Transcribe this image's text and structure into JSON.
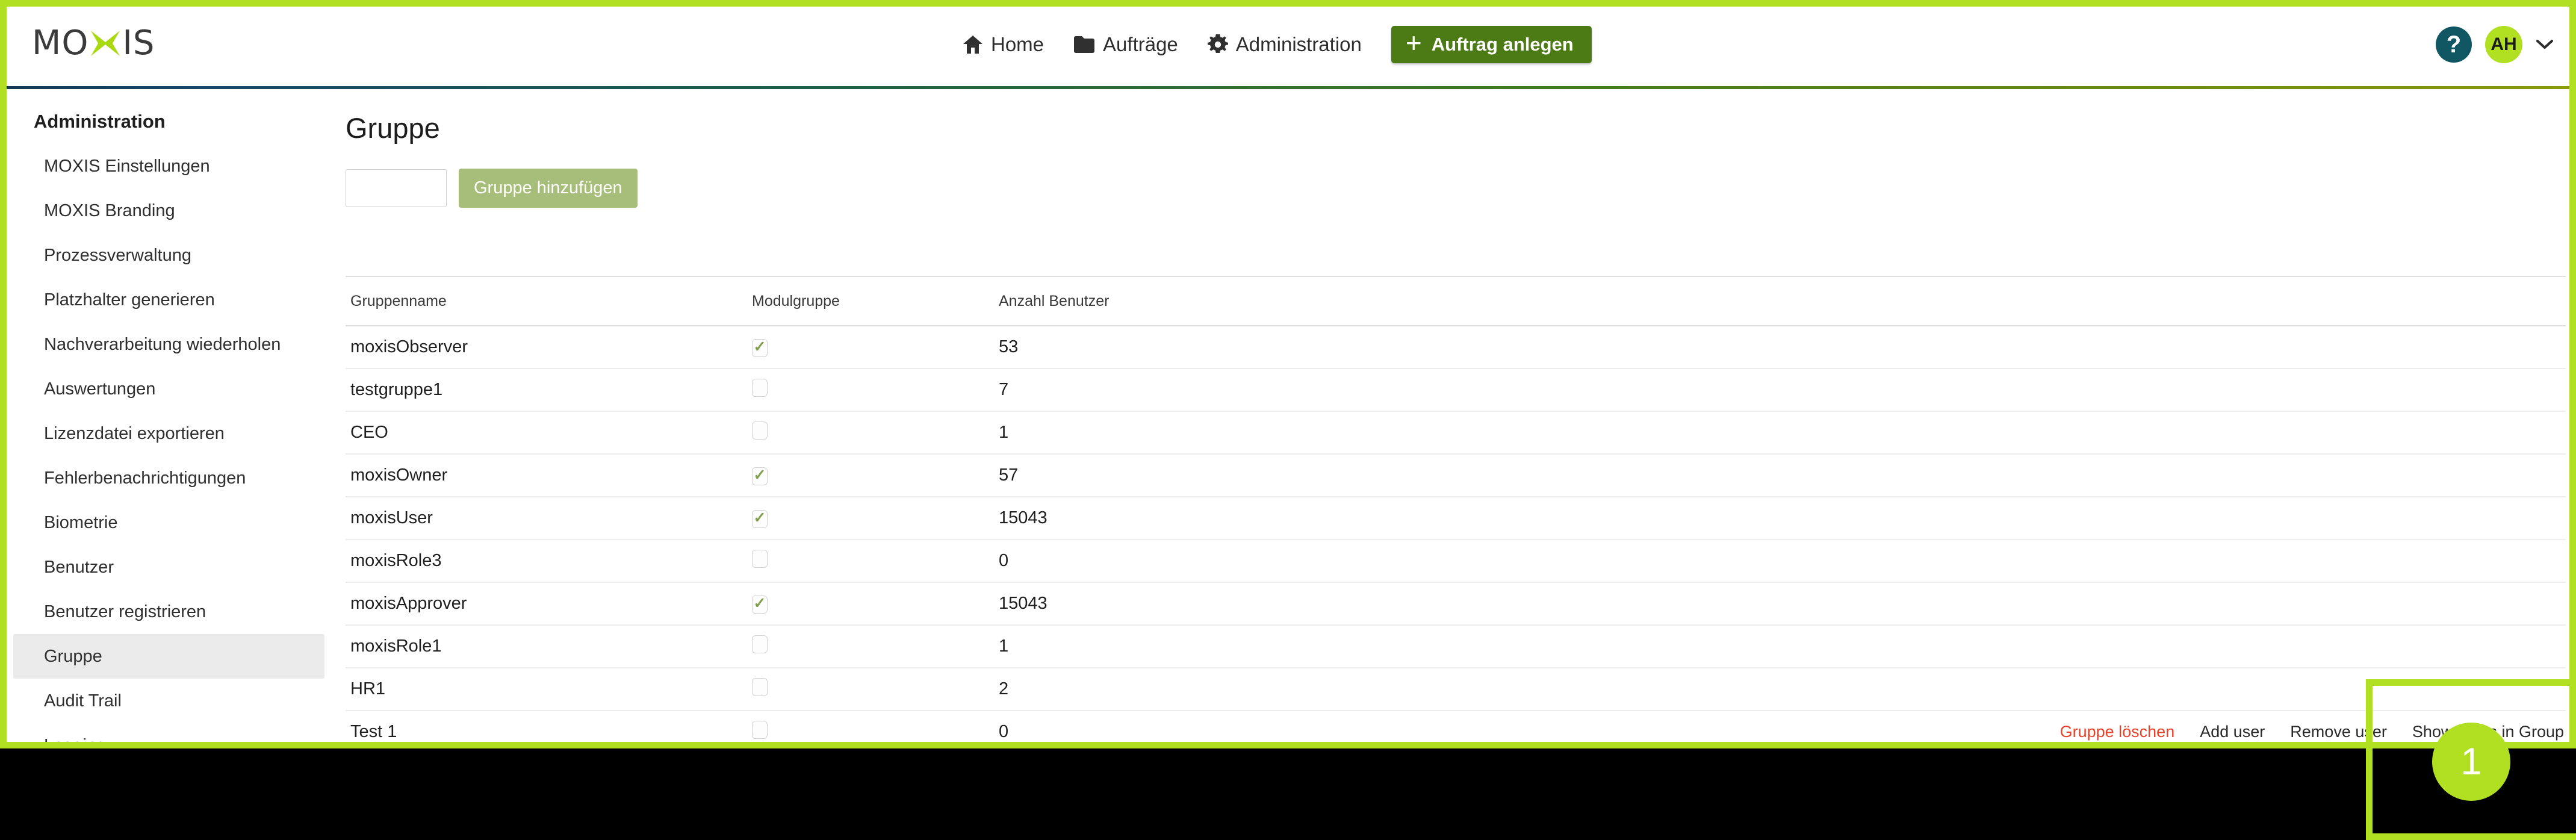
{
  "brand": {
    "logo_text_left": "MO",
    "logo_text_right": "IS",
    "logo_icon": "moxis-x-logo",
    "accent_green": "#b0e021",
    "button_green": "#4c7a15",
    "help_teal": "#105663",
    "danger_red": "#e8432b"
  },
  "topnav": {
    "items": [
      {
        "label": "Home",
        "icon": "home-icon"
      },
      {
        "label": "Aufträge",
        "icon": "folder-icon"
      },
      {
        "label": "Administration",
        "icon": "gear-icon"
      }
    ],
    "create_button": {
      "label": "Auftrag anlegen",
      "icon": "plus-icon"
    },
    "help": {
      "label": "?",
      "icon": "help-icon"
    },
    "avatar": {
      "initials": "AH"
    },
    "caret": {
      "icon": "chevron-down-icon"
    }
  },
  "sidebar": {
    "title": "Administration",
    "items": [
      {
        "label": "MOXIS Einstellungen",
        "active": false
      },
      {
        "label": "MOXIS Branding",
        "active": false
      },
      {
        "label": "Prozessverwaltung",
        "active": false
      },
      {
        "label": "Platzhalter generieren",
        "active": false
      },
      {
        "label": "Nachverarbeitung wiederholen",
        "active": false
      },
      {
        "label": "Auswertungen",
        "active": false
      },
      {
        "label": "Lizenzdatei exportieren",
        "active": false
      },
      {
        "label": "Fehlerbenachrichtigungen",
        "active": false
      },
      {
        "label": "Biometrie",
        "active": false
      },
      {
        "label": "Benutzer",
        "active": false
      },
      {
        "label": "Benutzer registrieren",
        "active": false
      },
      {
        "label": "Gruppe",
        "active": true
      },
      {
        "label": "Audit Trail",
        "active": false
      },
      {
        "label": "Logging",
        "active": false
      }
    ]
  },
  "main": {
    "page_title": "Gruppe",
    "group_input": {
      "value": "",
      "placeholder": ""
    },
    "add_group_button": "Gruppe hinzufügen",
    "table": {
      "columns": [
        "Gruppenname",
        "Modulgruppe",
        "Anzahl Benutzer",
        ""
      ],
      "rows": [
        {
          "name": "moxisObserver",
          "modulgruppe": true,
          "count": "53"
        },
        {
          "name": "testgruppe1",
          "modulgruppe": false,
          "count": "7"
        },
        {
          "name": "CEO",
          "modulgruppe": false,
          "count": "1"
        },
        {
          "name": "moxisOwner",
          "modulgruppe": true,
          "count": "57"
        },
        {
          "name": "moxisUser",
          "modulgruppe": true,
          "count": "15043"
        },
        {
          "name": "moxisRole3",
          "modulgruppe": false,
          "count": "0"
        },
        {
          "name": "moxisApprover",
          "modulgruppe": true,
          "count": "15043"
        },
        {
          "name": "moxisRole1",
          "modulgruppe": false,
          "count": "1"
        },
        {
          "name": "HR1",
          "modulgruppe": false,
          "count": "2"
        },
        {
          "name": "Test 1",
          "modulgruppe": false,
          "count": "0"
        }
      ],
      "row_actions": {
        "delete": "Gruppe löschen",
        "add_user": "Add user",
        "remove_user": "Remove user",
        "show_users": "Show users in Group"
      }
    }
  },
  "annotation": {
    "step_number": "1",
    "target": "show-users-in-group-link"
  }
}
